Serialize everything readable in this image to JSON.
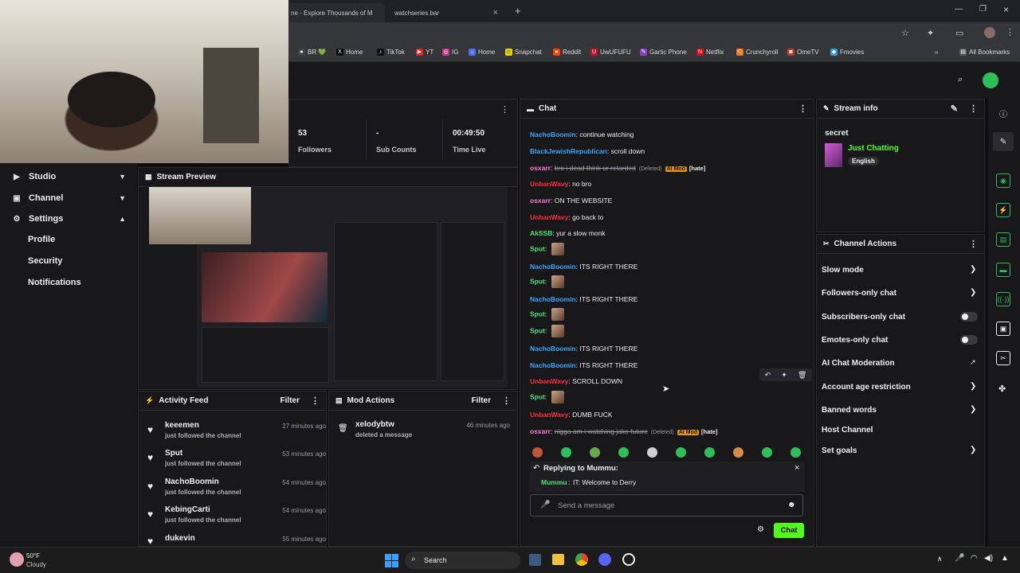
{
  "browser": {
    "tabs": [
      {
        "title": "ne - Explore Thousands of M"
      },
      {
        "title": "watchseries.bar"
      }
    ],
    "new_tab": "+",
    "bookmarks": [
      "BR 💚",
      "Home",
      "TikTok",
      "YT",
      "IG",
      "Home",
      "Snapchat",
      "Reddit",
      "UwUFUFU",
      "Gartic Phone",
      "Netflix",
      "Crunchyroll",
      "OmeTV",
      "Fmovies"
    ],
    "all_bookmarks": "All Bookmarks"
  },
  "sidebar": {
    "items": [
      {
        "label": "Studio"
      },
      {
        "label": "Channel"
      },
      {
        "label": "Settings"
      }
    ],
    "sub_items": [
      "Profile",
      "Security",
      "Notifications"
    ]
  },
  "stats": [
    {
      "value": "53",
      "label": "Followers"
    },
    {
      "value": "-",
      "label": "Sub Counts"
    },
    {
      "value": "00:49:50",
      "label": "Time Live"
    }
  ],
  "stream_preview": {
    "title": "Stream Preview"
  },
  "activity_feed": {
    "title": "Activity Feed",
    "filter": "Filter",
    "items": [
      {
        "name": "keeemen",
        "sub": "just followed the channel",
        "time": "27 minutes ago"
      },
      {
        "name": "Sput",
        "sub": "just followed the channel",
        "time": "53 minutes ago"
      },
      {
        "name": "NachoBoomin",
        "sub": "just followed the channel",
        "time": "54 minutes ago"
      },
      {
        "name": "KebingCarti",
        "sub": "just followed the channel",
        "time": "54 minutes ago"
      },
      {
        "name": "dukevin",
        "sub": "",
        "time": "55 minutes ago"
      }
    ]
  },
  "mod_actions": {
    "title": "Mod Actions",
    "filter": "Filter",
    "items": [
      {
        "name": "xelodybtw",
        "sub": "deleted a message",
        "time": "46 minutes ago"
      }
    ]
  },
  "chat": {
    "title": "Chat",
    "lines": [
      {
        "user": "NachoBoomin",
        "color": "#3aa7ff",
        "text": "continue watching"
      },
      {
        "user": "BlackJewishRepublican",
        "color": "#3aa7ff",
        "text": "scroll down"
      },
      {
        "user": "osxarr",
        "color": "#ff7ad9",
        "text": "bro i dead think ur retarded",
        "deleted": true,
        "deleted_label": "(Deleted)",
        "badge": "AI Mod",
        "tag": "[hate]"
      },
      {
        "user": "UnbanWavy",
        "color": "#ff2e3e",
        "text": "no bro"
      },
      {
        "user": "osxarr",
        "color": "#ff7ad9",
        "text": "ON THE WEBSITE"
      },
      {
        "user": "UnbanWavy",
        "color": "#ff2e3e",
        "text": "go back to"
      },
      {
        "user": "AkSSB",
        "color": "#4ee07a",
        "text": "yur a slow monk"
      },
      {
        "user": "Sput",
        "color": "#4ee07a",
        "text": "",
        "image": true
      },
      {
        "user": "NachoBoomin",
        "color": "#3aa7ff",
        "text": "ITS RIGHT THERE"
      },
      {
        "user": "Sput",
        "color": "#4ee07a",
        "text": "",
        "image": true
      },
      {
        "user": "NachoBoomin",
        "color": "#3aa7ff",
        "text": "ITS RIGHT THERE"
      },
      {
        "user": "Sput",
        "color": "#4ee07a",
        "text": "",
        "image": true
      },
      {
        "user": "Sput",
        "color": "#4ee07a",
        "text": "",
        "image": true
      },
      {
        "user": "NachoBoomin",
        "color": "#3aa7ff",
        "text": "ITS RIGHT THERE"
      },
      {
        "user": "NachoBoomin",
        "color": "#3aa7ff",
        "text": "ITS RIGHT THERE"
      },
      {
        "user": "UnbanWavy",
        "color": "#ff2e3e",
        "text": "SCROLL DOWN"
      },
      {
        "user": "Sput",
        "color": "#4ee07a",
        "text": "",
        "image": true
      },
      {
        "user": "UnbanWavy",
        "color": "#ff2e3e",
        "text": "DUMB FUCK"
      },
      {
        "user": "osxarr",
        "color": "#ff7ad9",
        "text": "nigga am i watching jake future",
        "deleted": true,
        "deleted_label": "(Deleted)",
        "badge": "AI Mod",
        "tag": "[hate]"
      }
    ],
    "reply": {
      "label": "Replying to Mummu:",
      "user": "Mummu",
      "text": "IT: Welcome to Derry"
    },
    "input_placeholder": "Send a message",
    "send_label": "Chat"
  },
  "stream_info": {
    "title": "Stream info",
    "stream_title": "secret",
    "category": "Just Chatting",
    "language": "English"
  },
  "channel_actions": {
    "title": "Channel Actions",
    "items": [
      {
        "label": "Slow mode",
        "control": "chevron"
      },
      {
        "label": "Followers-only chat",
        "control": "chevron"
      },
      {
        "label": "Subscribers-only chat",
        "control": "toggle"
      },
      {
        "label": "Emotes-only chat",
        "control": "toggle"
      },
      {
        "label": "AI Chat Moderation",
        "control": "external"
      },
      {
        "label": "Account age restriction",
        "control": "chevron"
      },
      {
        "label": "Banned words",
        "control": "chevron"
      },
      {
        "label": "Host Channel",
        "control": "none"
      },
      {
        "label": "Set goals",
        "control": "chevron"
      }
    ]
  },
  "taskbar": {
    "weather_temp": "50°F",
    "weather_desc": "Cloudy",
    "search": "Search"
  },
  "colors": {
    "accent": "#53fc18",
    "panel": "#18181b",
    "border": "#2b2b30"
  }
}
